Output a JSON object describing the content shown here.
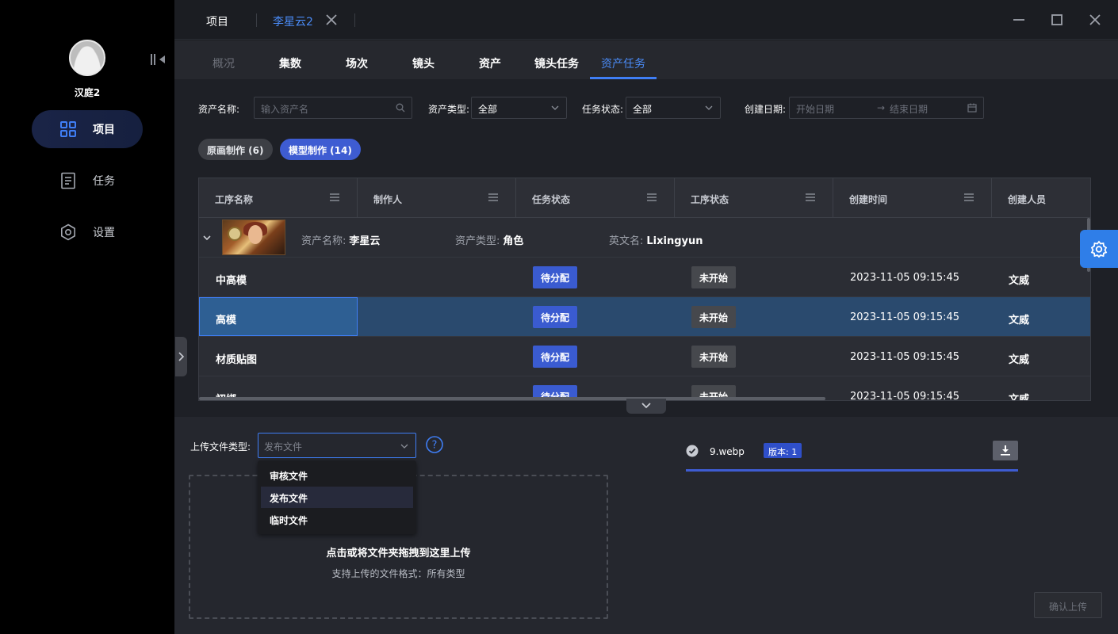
{
  "user": {
    "name": "汉庭2"
  },
  "sidebar": {
    "items": [
      {
        "label": "项目",
        "icon": "grid-icon",
        "active": true
      },
      {
        "label": "任务",
        "icon": "document-icon",
        "active": false
      },
      {
        "label": "设置",
        "icon": "gear-icon",
        "active": false
      }
    ]
  },
  "titlebar": {
    "project_tab": "项目",
    "active_tab": "李星云2"
  },
  "subtabs": [
    {
      "label": "概况",
      "state": "disabled"
    },
    {
      "label": "集数",
      "state": "normal"
    },
    {
      "label": "场次",
      "state": "normal"
    },
    {
      "label": "镜头",
      "state": "normal"
    },
    {
      "label": "资产",
      "state": "normal"
    },
    {
      "label": "镜头任务",
      "state": "normal"
    },
    {
      "label": "资产任务",
      "state": "active"
    }
  ],
  "filters": {
    "asset_name_label": "资产名称:",
    "asset_name_placeholder": "输入资产名",
    "asset_type_label": "资产类型:",
    "asset_type_value": "全部",
    "task_status_label": "任务状态:",
    "task_status_value": "全部",
    "created_date_label": "创建日期:",
    "start_placeholder": "开始日期",
    "end_placeholder": "结束日期"
  },
  "pills": [
    {
      "label": "原画制作 (6)",
      "active": false
    },
    {
      "label": "模型制作 (14)",
      "active": true
    }
  ],
  "table": {
    "headers": [
      "工序名称",
      "制作人",
      "任务状态",
      "工序状态",
      "创建时间",
      "创建人员"
    ],
    "group": {
      "asset_name_label": "资产名称:",
      "asset_name": "李星云",
      "asset_type_label": "资产类型:",
      "asset_type": "角色",
      "english_name_label": "英文名:",
      "english_name": "Lixingyun"
    },
    "rows": [
      {
        "name": "中高模",
        "maker": "",
        "task_status": "待分配",
        "process_status": "未开始",
        "created": "2023-11-05 09:15:45",
        "creator": "文威",
        "selected": false
      },
      {
        "name": "高模",
        "maker": "",
        "task_status": "待分配",
        "process_status": "未开始",
        "created": "2023-11-05 09:15:45",
        "creator": "文威",
        "selected": true
      },
      {
        "name": "材质贴图",
        "maker": "",
        "task_status": "待分配",
        "process_status": "未开始",
        "created": "2023-11-05 09:15:45",
        "creator": "文威",
        "selected": false
      },
      {
        "name": "初绑",
        "maker": "",
        "task_status": "待分配",
        "process_status": "未开始",
        "created": "2023-11-05 09:15:45",
        "creator": "文威",
        "selected": false
      }
    ]
  },
  "upload": {
    "type_label": "上传文件类型:",
    "type_placeholder": "发布文件",
    "dropdown_options": [
      "审核文件",
      "发布文件",
      "临时文件"
    ],
    "dropdown_highlight": "发布文件",
    "dropzone_title": "点击或将文件夹拖拽到这里上传",
    "dropzone_sub": "支持上传的文件格式：所有类型",
    "file_name": "9.webp",
    "version_badge": "版本: 1",
    "progress": 1.0,
    "confirm_label": "确认上传"
  },
  "colors": {
    "accent": "#3f7ef5",
    "badge_blue": "#3a5bd0",
    "badge_gray": "#46484d",
    "selected_row": "#2a4a6e"
  }
}
